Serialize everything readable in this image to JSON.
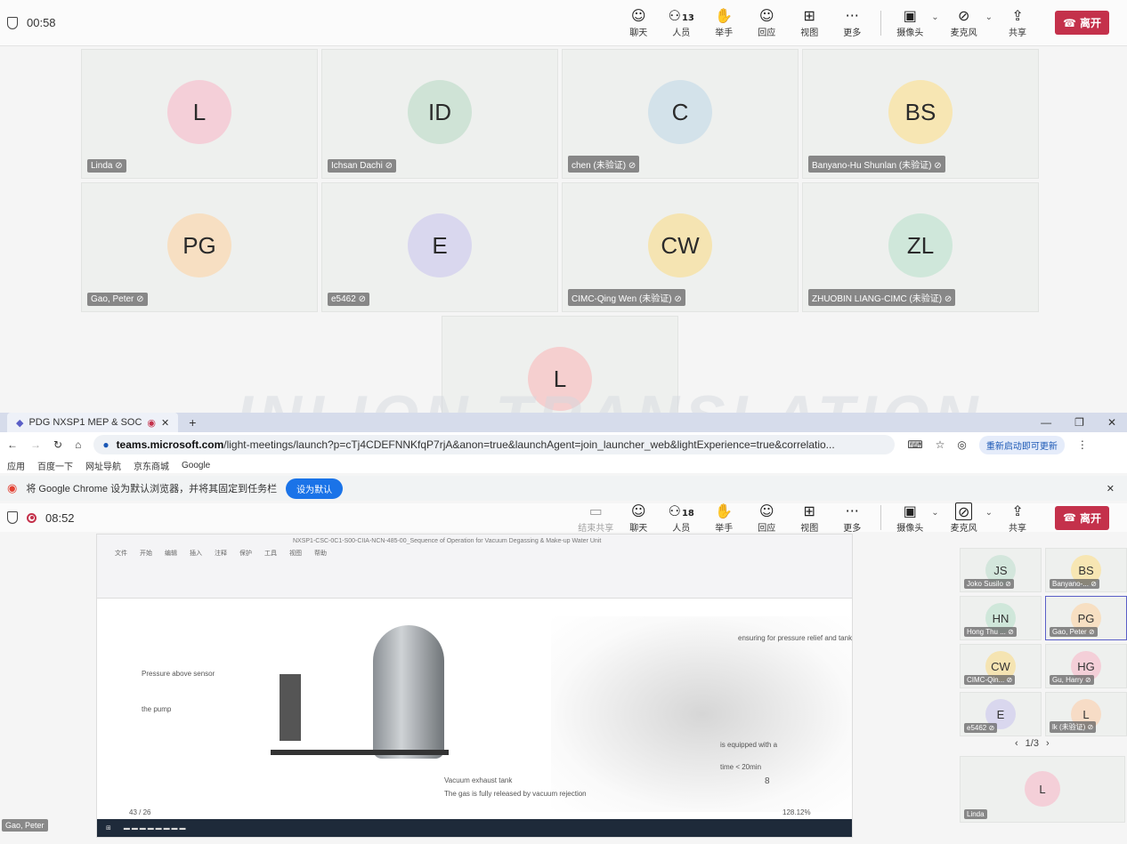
{
  "top_meeting": {
    "timer": "00:58",
    "controls": [
      {
        "name": "chat",
        "label": "聊天",
        "icon": "chat-icon"
      },
      {
        "name": "people",
        "label": "人员",
        "count": "13",
        "icon": "people-icon"
      },
      {
        "name": "raise-hand",
        "label": "举手",
        "icon": "hand-icon"
      },
      {
        "name": "react",
        "label": "回应",
        "icon": "smile-icon"
      },
      {
        "name": "view",
        "label": "视图",
        "icon": "grid-icon"
      },
      {
        "name": "more",
        "label": "更多",
        "icon": "more-icon"
      },
      {
        "name": "camera",
        "label": "摄像头",
        "icon": "camera-off-icon"
      },
      {
        "name": "mic",
        "label": "麦克风",
        "icon": "mic-off-icon"
      },
      {
        "name": "share",
        "label": "共享",
        "icon": "share-icon"
      }
    ],
    "leave": "离开",
    "participants": [
      {
        "initials": "L",
        "name": "Linda",
        "color": "#f4cfd8"
      },
      {
        "initials": "ID",
        "name": "Ichsan Dachi",
        "color": "#cfe3d6"
      },
      {
        "initials": "C",
        "name": "chen (未验证)",
        "color": "#d3e2ea"
      },
      {
        "initials": "BS",
        "name": "Banyano-Hu Shunlan (未验证)",
        "color": "#f7e6b3"
      },
      {
        "initials": "PG",
        "name": "Gao, Peter",
        "color": "#f7dfc2"
      },
      {
        "initials": "E",
        "name": "e5462",
        "color": "#d9d7ee"
      },
      {
        "initials": "CW",
        "name": "CIMC-Qing Wen (未验证)",
        "color": "#f5e4b2"
      },
      {
        "initials": "ZL",
        "name": "ZHUOBIN LIANG-CIMC (未验证)",
        "color": "#cfe7da"
      },
      {
        "initials": "L",
        "name": "",
        "color": "#f5cfcf"
      }
    ]
  },
  "watermark": "INLION TRANSLATION",
  "browser": {
    "tab_title": "PDG NXSP1 MEP & SOC",
    "new_tab": "+",
    "url_host": "teams.microsoft.com",
    "url_rest": "/light-meetings/launch?p=cTj4CDEFNNKfqP7rjA&anon=true&launchAgent=join_launcher_web&lightExperience=true&correlatio...",
    "update_btn": "重新启动即可更新",
    "bookmarks": [
      "应用",
      "百度一下",
      "网址导航",
      "京东商城",
      "Google"
    ],
    "notice": "将 Google Chrome 设为默认浏览器，并将其固定到任务栏",
    "set_default": "设为默认"
  },
  "bottom_meeting": {
    "timer": "08:52",
    "controls": [
      {
        "name": "stop-share",
        "label": "结束共享",
        "icon": "screen-icon"
      },
      {
        "name": "chat",
        "label": "聊天",
        "icon": "chat-icon"
      },
      {
        "name": "people",
        "label": "人员",
        "count": "18",
        "icon": "people-icon"
      },
      {
        "name": "raise-hand",
        "label": "举手",
        "icon": "hand-icon"
      },
      {
        "name": "react",
        "label": "回应",
        "icon": "smile-icon"
      },
      {
        "name": "view",
        "label": "视图",
        "icon": "grid-icon"
      },
      {
        "name": "more",
        "label": "更多",
        "icon": "more-icon"
      },
      {
        "name": "camera",
        "label": "摄像头",
        "icon": "camera-off-icon"
      },
      {
        "name": "mic",
        "label": "麦克风",
        "icon": "mic-off-icon"
      },
      {
        "name": "share",
        "label": "共享",
        "icon": "share-icon"
      }
    ],
    "leave": "离开",
    "side_participants": [
      {
        "initials": "JS",
        "name": "Joko Susilo",
        "color": "#d3e6dc"
      },
      {
        "initials": "BS",
        "name": "Banyano-...",
        "color": "#f7e6b3"
      },
      {
        "initials": "HN",
        "name": "Hong Thu ...",
        "color": "#cfe7da"
      },
      {
        "initials": "PG",
        "name": "Gao, Peter",
        "color": "#f7dfc2"
      },
      {
        "initials": "CW",
        "name": "CIMC-Qin...",
        "color": "#f5e4b2"
      },
      {
        "initials": "HG",
        "name": "Gu, Harry",
        "color": "#f4cfd8"
      },
      {
        "initials": "E",
        "name": "e5462",
        "color": "#d9d7ee"
      },
      {
        "initials": "L",
        "name": "lk (未验证)",
        "color": "#f7dcc6"
      }
    ],
    "pager": "1/3",
    "big_tile": {
      "initials": "L",
      "name": "Linda",
      "color": "#f4cfd8"
    },
    "presenter_label": "Gao, Peter",
    "shared_doc": {
      "title": "NXSP1-CSC-0C1-S00-CIIA-NCN-485-00_Sequence of Operation for Vacuum Degassing & Make-up Water Unit",
      "ribbon_tabs": [
        "文件",
        "开始",
        "编辑",
        "插入",
        "注释",
        "保护",
        "工具",
        "视图",
        "帮助"
      ],
      "page_number": "8",
      "notes": [
        "Pressure above sensor",
        "the pump",
        "The gas is fully released by vacuum rejection",
        "Vacuum exhaust tank",
        "ensuring for pressure relief and tank protection",
        "is equipped with a",
        "time < 20min"
      ],
      "page_indicator": "43 / 26",
      "zoom": "128.12%"
    }
  }
}
